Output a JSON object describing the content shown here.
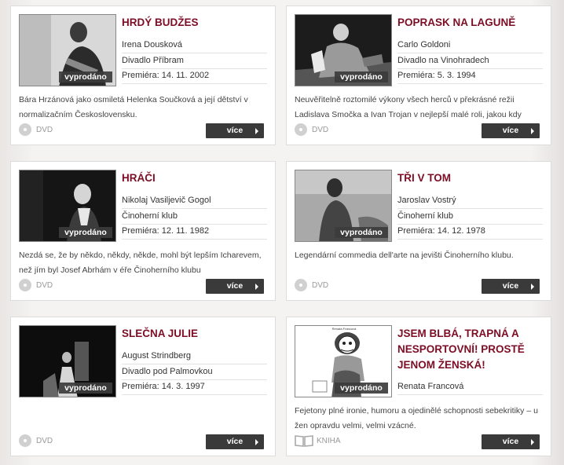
{
  "cards": [
    {
      "title": "HRDÝ BUDŽES",
      "author": "Irena Dousková",
      "theatre": "Divadlo Příbram",
      "premiere": "Premiéra: 14. 11. 2002",
      "description": "Bára Hrzánová jako osmiletá Helenka Součková a její dětství v normalizačním Československu.",
      "badge": "vyprodáno",
      "media": "DVD",
      "more": "více"
    },
    {
      "title": "POPRASK NA LAGUNĚ",
      "author": "Carlo Goldoni",
      "theatre": "Divadlo na Vinohradech",
      "premiere": "Premiéra: 5. 3. 1994",
      "description": "Neuvěřitelně roztomilé výkony všech herců v překrásné režii Ladislava Smočka a Ivan Trojan v nejlepší malé roli, jakou kdy",
      "badge": "vyprodáno",
      "media": "DVD",
      "more": "více"
    },
    {
      "title": "HRÁČI",
      "author": "Nikolaj Vasiljevič Gogol",
      "theatre": "Činoherní klub",
      "premiere": "Premiéra: 12. 11. 1982",
      "description": "Nezdá se, že by někdo, někdy, někde, mohl být lepším Icharevem, než jím byl Josef Abrhám v éře Činoherního klubu",
      "badge": "vyprodáno",
      "media": "DVD",
      "more": "více"
    },
    {
      "title": "TŘI V TOM",
      "author": "Jaroslav Vostrý",
      "theatre": "Činoherní klub",
      "premiere": "Premiéra: 14. 12. 1978",
      "description": "Legendární commedia dell'arte na jevišti Činoherního klubu.",
      "badge": "vyprodáno",
      "media": "DVD",
      "more": "více"
    },
    {
      "title": "SLEČNA JULIE",
      "author": "August Strindberg",
      "theatre": "Divadlo pod Palmovkou",
      "premiere": "Premiéra: 14. 3. 1997",
      "description": "",
      "badge": "vyprodáno",
      "media": "DVD",
      "more": "více"
    },
    {
      "title": "JSEM BLBÁ, TRAPNÁ A NESPORTOVNÍ! PROSTĚ JENOM ŽENSKÁ!",
      "author": "Renata Francová",
      "description": "Fejetony plné ironie, humoru a ojedinělé schopnosti sebekritiky – u žen opravdu velmi, velmi vzácné.",
      "badge": "vyprodáno",
      "media": "KNIHA",
      "more": "více",
      "cover_caption": "Renata Francová"
    }
  ]
}
